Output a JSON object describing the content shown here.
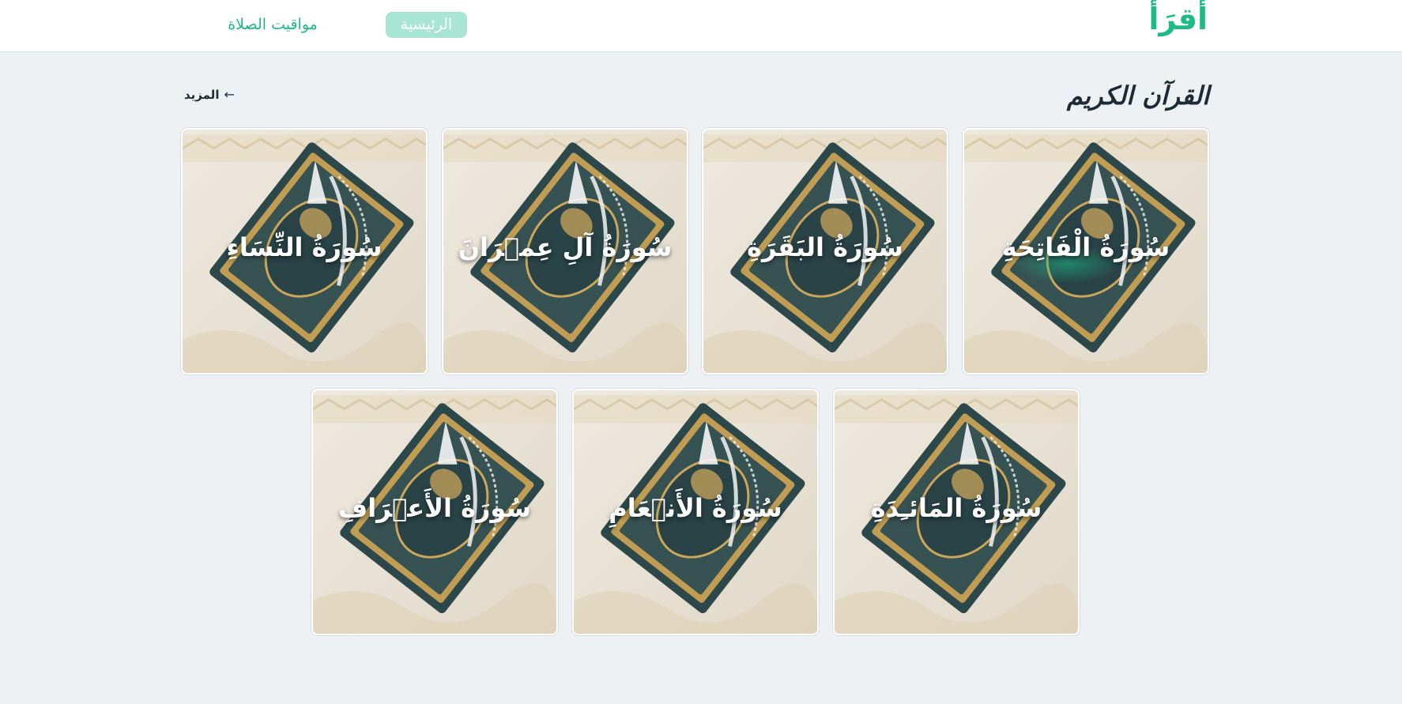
{
  "header": {
    "brand": "أَقرَأ",
    "nav": {
      "home": "الرئيسية",
      "prayer_times": "مواقيت الصلاة"
    }
  },
  "section": {
    "title": "القرآن الكريم",
    "more_label": "المزيد",
    "more_icon": "arrow-left-icon"
  },
  "surahs": [
    "سُورَةُ الْفَاتِحَةِ",
    "سُورَةُ البَقَرَةِ",
    "سُورَةُ آلِ عِمۡرَانَ",
    "سُورَةُ النِّسَاءِ",
    "سُورَةُ المَائـِدَةِ",
    "سُورَةُ الأَنۡعَامِ",
    "سُورَةُ الأَعۡرَافِ"
  ],
  "colors": {
    "accent": "#1dbb86",
    "accent_soft": "#a8e6d3",
    "page_bg": "#edf1f4",
    "title_text": "#1f2a37"
  }
}
